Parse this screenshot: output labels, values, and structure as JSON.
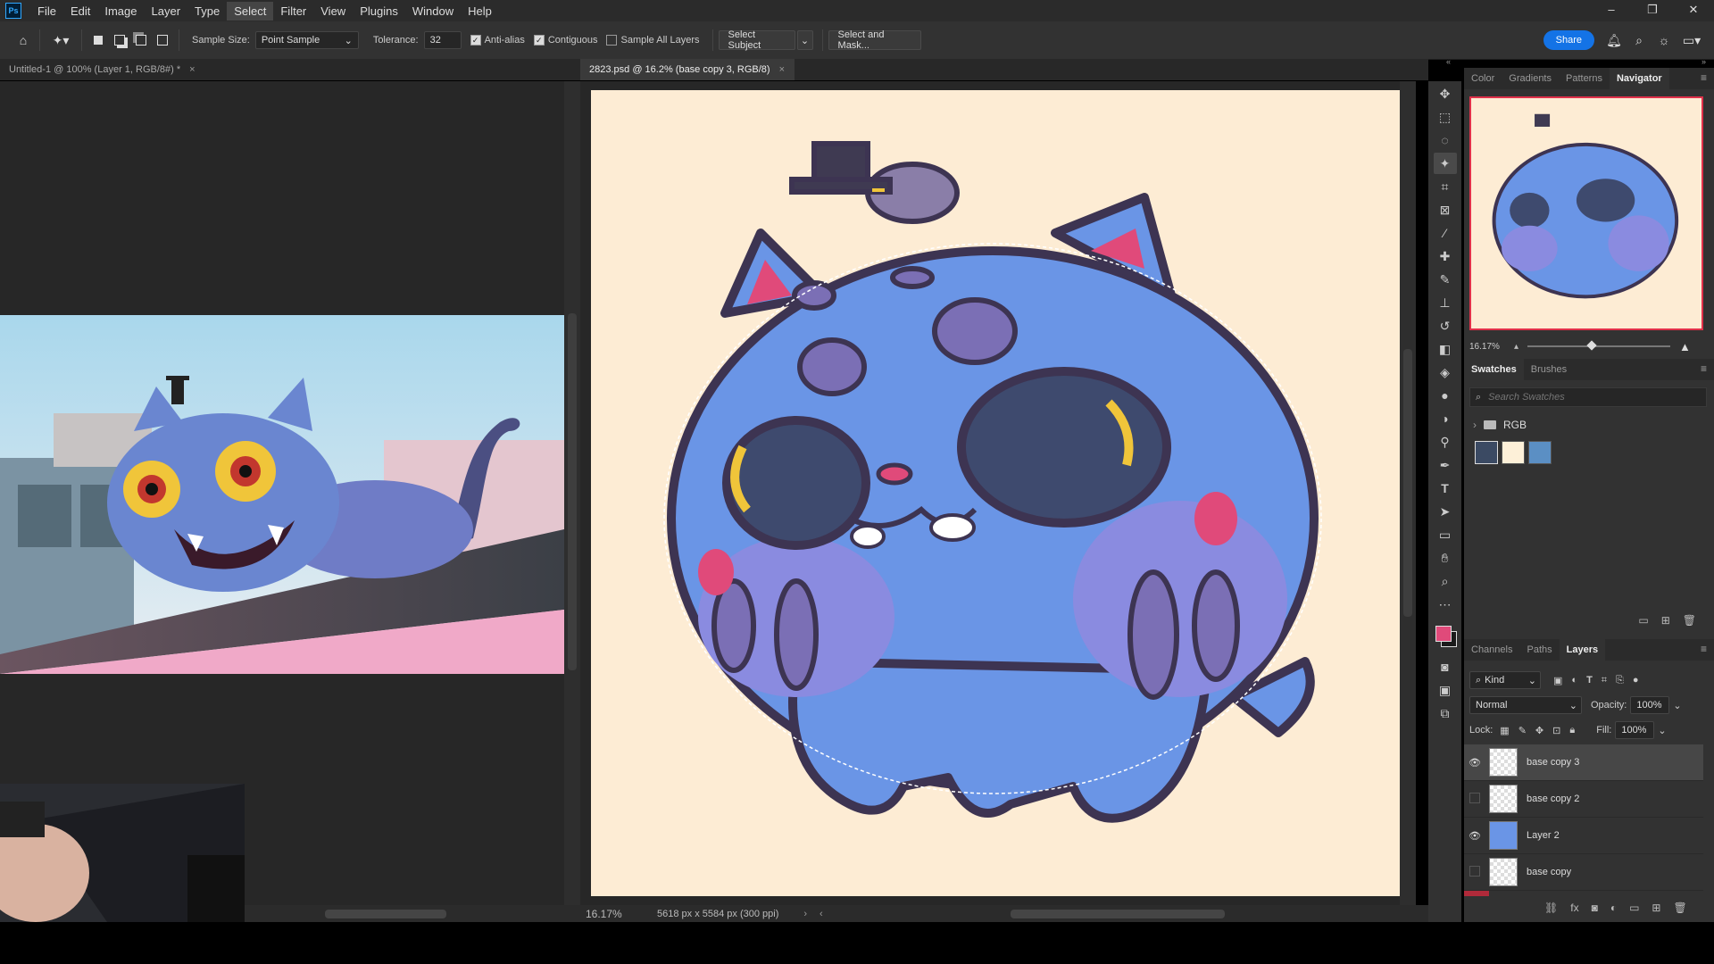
{
  "app": {
    "logo": "Ps"
  },
  "menu": [
    "File",
    "Edit",
    "Image",
    "Layer",
    "Type",
    "Select",
    "Filter",
    "View",
    "Plugins",
    "Window",
    "Help"
  ],
  "menu_active": "Select",
  "window_controls": {
    "minimize": "–",
    "restore": "❐",
    "close": "✕"
  },
  "options": {
    "sample_size_label": "Sample Size:",
    "sample_size_value": "Point Sample",
    "tolerance_label": "Tolerance:",
    "tolerance_value": "32",
    "anti_alias": "Anti-alias",
    "contiguous": "Contiguous",
    "sample_all_layers": "Sample All Layers",
    "select_subject": "Select Subject",
    "select_and_mask": "Select and Mask...",
    "share": "Share"
  },
  "documents": [
    {
      "title": "Untitled-1 @ 100% (Layer 1, RGB/8#) *",
      "active": false
    },
    {
      "title": "2823.psd @ 16.2% (base copy 3, RGB/8)",
      "active": true
    }
  ],
  "status": {
    "zoom": "16.17%",
    "info": "5618 px x 5584 px (300 ppi)"
  },
  "panels": {
    "top_tabs": [
      "Color",
      "Gradients",
      "Patterns",
      "Navigator"
    ],
    "top_active": "Navigator",
    "navigator_zoom": "16.17%",
    "mid_tabs": [
      "Swatches",
      "Brushes"
    ],
    "mid_active": "Swatches",
    "swatch_search_placeholder": "Search Swatches",
    "swatch_group": "RGB",
    "swatch_colors": [
      "#3b4a63",
      "#fdf0d8",
      "#5b8fc4"
    ],
    "bottom_tabs": [
      "Channels",
      "Paths",
      "Layers"
    ],
    "bottom_active": "Layers",
    "filter_kind": "Kind",
    "blend_mode": "Normal",
    "opacity_label": "Opacity:",
    "opacity_value": "100%",
    "lock_label": "Lock:",
    "fill_label": "Fill:",
    "fill_value": "100%",
    "layers": [
      {
        "name": "base copy 3",
        "visible": true,
        "selected": true
      },
      {
        "name": "base copy 2",
        "visible": false,
        "selected": false
      },
      {
        "name": "Layer 2",
        "visible": true,
        "selected": false
      },
      {
        "name": "base copy",
        "visible": false,
        "selected": false
      }
    ]
  },
  "colors": {
    "foreground": "#e04a7a",
    "background": "#1a1a1a",
    "canvas_bg": "#fdecd4",
    "accent": "#1473e6"
  }
}
